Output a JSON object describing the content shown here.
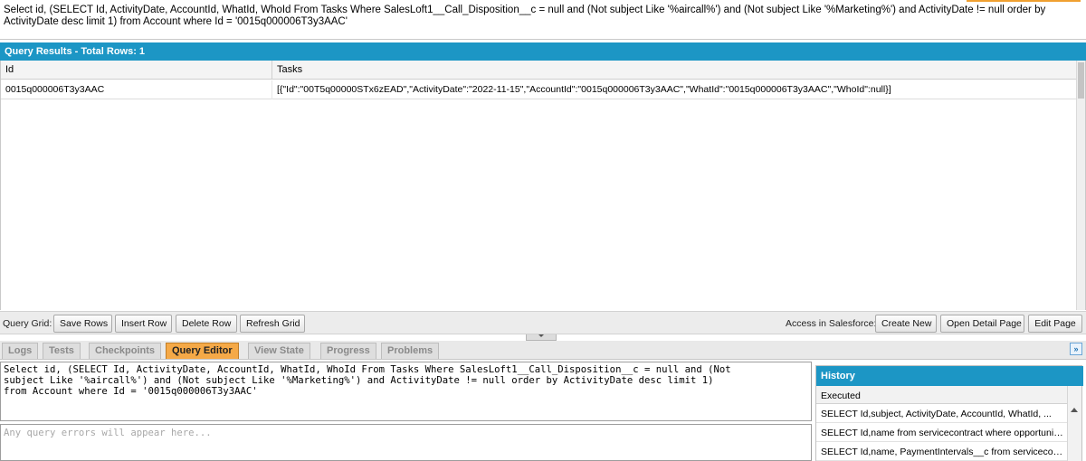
{
  "top_query": {
    "text": "Select id, (SELECT Id, ActivityDate, AccountId, WhatId, WhoId From Tasks Where SalesLoft1__Call_Disposition__c = null and (Not subject Like '%aircall%') and (Not subject Like '%Marketing%') and ActivityDate != null order by ActivityDate desc limit 1) from Account where Id = '0015q000006T3y3AAC'"
  },
  "results": {
    "title": "Query Results - Total Rows: 1",
    "columns": [
      "Id",
      "Tasks"
    ],
    "rows": [
      {
        "id": "0015q000006T3y3AAC",
        "tasks": "[{\"Id\":\"00T5q00000STx6zEAD\",\"ActivityDate\":\"2022-11-15\",\"AccountId\":\"0015q000006T3y3AAC\",\"WhatId\":\"0015q000006T3y3AAC\",\"WhoId\":null}]"
      }
    ]
  },
  "toolbar": {
    "grid_label": "Query Grid:",
    "save_rows": "Save Rows",
    "insert_row": "Insert Row",
    "delete_row": "Delete Row",
    "refresh_grid": "Refresh Grid",
    "access_label": "Access in Salesforce:",
    "create_new": "Create New",
    "open_detail": "Open Detail Page",
    "edit_page": "Edit Page"
  },
  "tabs": [
    {
      "label": "Logs"
    },
    {
      "label": "Tests"
    },
    {
      "label": "Checkpoints"
    },
    {
      "label": "Query Editor",
      "active": true
    },
    {
      "label": "View State"
    },
    {
      "label": "Progress"
    },
    {
      "label": "Problems"
    }
  ],
  "editor": {
    "text": "Select id, (SELECT Id, ActivityDate, AccountId, WhatId, WhoId From Tasks Where SalesLoft1__Call_Disposition__c = null and (Not\nsubject Like '%aircall%') and (Not subject Like '%Marketing%') and ActivityDate != null order by ActivityDate desc limit 1)\nfrom Account where Id = '0015q000006T3y3AAC'",
    "errors_placeholder": "Any query errors will appear here..."
  },
  "history": {
    "title": "History",
    "subheader": "Executed",
    "items": [
      "SELECT Id,subject, ActivityDate, AccountId, WhatId, ...",
      "SELECT Id,name from servicecontract where opportunit...",
      "SELECT Id,name, PaymentIntervals__c from servicecon..."
    ]
  },
  "colors": {
    "header_blue": "#1c96c5",
    "active_tab_orange": "#f5a947"
  },
  "icons": {
    "collapse": "double-chevron-down-icon",
    "splitter": "triangle-down-icon",
    "scroll_up": "triangle-up-icon"
  }
}
